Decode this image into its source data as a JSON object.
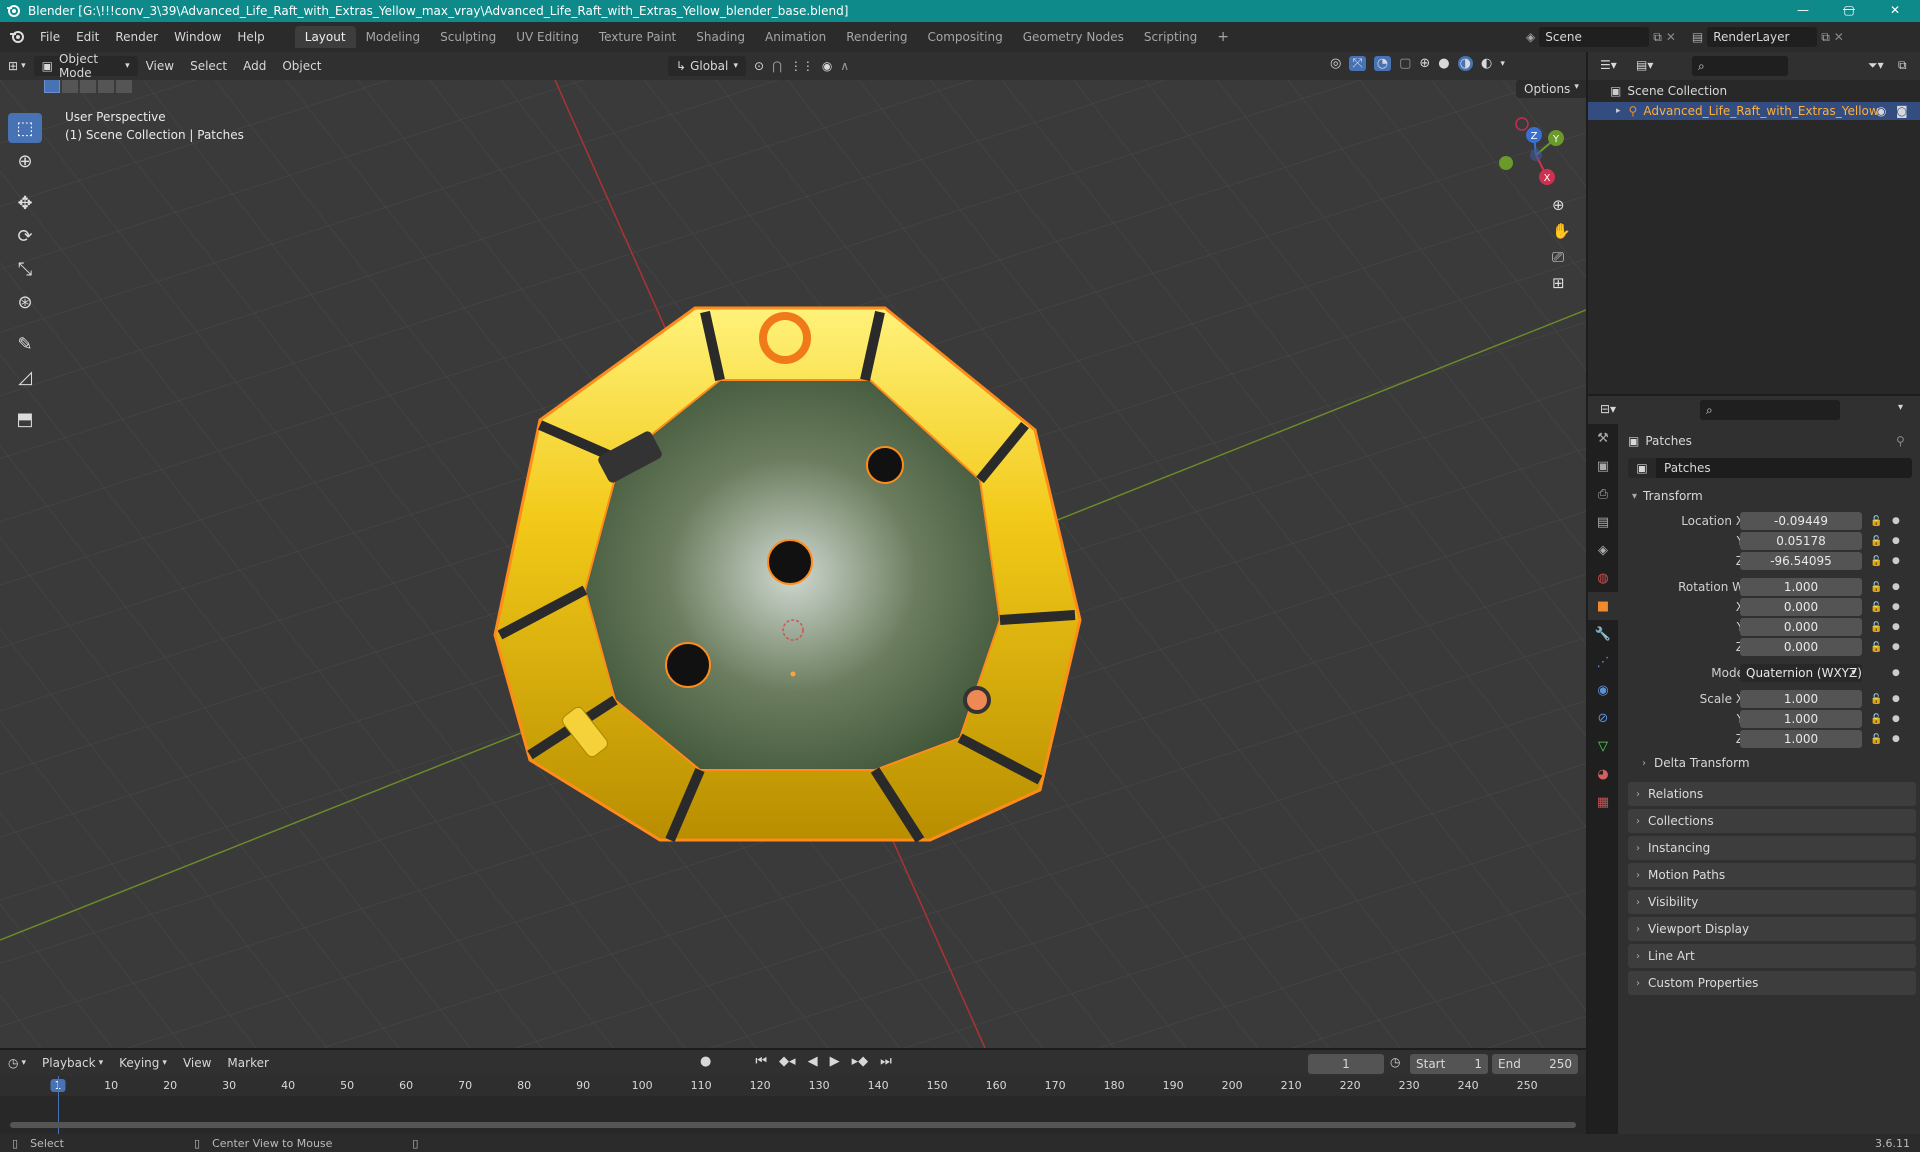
{
  "window": {
    "title": "Blender [G:\\!!!conv_3\\39\\Advanced_Life_Raft_with_Extras_Yellow_max_vray\\Advanced_Life_Raft_with_Extras_Yellow_blender_base.blend]",
    "minimize": "—",
    "maximize": "▢",
    "close": "✕"
  },
  "menu": [
    "File",
    "Edit",
    "Render",
    "Window",
    "Help"
  ],
  "workspaces": [
    "Layout",
    "Modeling",
    "Sculpting",
    "UV Editing",
    "Texture Paint",
    "Shading",
    "Animation",
    "Rendering",
    "Compositing",
    "Geometry Nodes",
    "Scripting"
  ],
  "add_workspace": "+",
  "scene": {
    "name": "Scene",
    "render_layer": "RenderLayer"
  },
  "viewport_header": {
    "mode": "Object Mode",
    "menus": [
      "View",
      "Select",
      "Add",
      "Object"
    ],
    "orientation": "Global",
    "options": "Options"
  },
  "viewport": {
    "perspective": "User Perspective",
    "collection_info": "(1) Scene Collection | Patches",
    "gizmo": {
      "x": "X",
      "y": "Y",
      "z": "Z"
    }
  },
  "outliner": {
    "root": "Scene Collection",
    "item": "Advanced_Life_Raft_with_Extras_Yellow"
  },
  "properties": {
    "object_name": "Patches",
    "datablock": "Patches",
    "transform_title": "Transform",
    "location": {
      "label_x": "Location X",
      "x": "-0.09449",
      "label_y": "Y",
      "y": "0.05178",
      "label_z": "Z",
      "z": "-96.54095"
    },
    "rotation": {
      "label_w": "Rotation W",
      "w": "1.000",
      "label_x": "X",
      "x": "0.000",
      "label_y": "Y",
      "y": "0.000",
      "label_z": "Z",
      "z": "0.000"
    },
    "mode_label": "Mode",
    "mode": "Quaternion (WXYZ)",
    "scale": {
      "label_x": "Scale X",
      "x": "1.000",
      "label_y": "Y",
      "y": "1.000",
      "label_z": "Z",
      "z": "1.000"
    },
    "delta_transform": "Delta Transform",
    "panels": [
      "Relations",
      "Collections",
      "Instancing",
      "Motion Paths",
      "Visibility",
      "Viewport Display",
      "Line Art",
      "Custom Properties"
    ]
  },
  "timeline": {
    "menus": [
      "Playback",
      "Keying",
      "View",
      "Marker"
    ],
    "current_frame": "1",
    "start_label": "Start",
    "start": "1",
    "end_label": "End",
    "end": "250",
    "ticks": [
      "1",
      "10",
      "20",
      "30",
      "40",
      "50",
      "60",
      "70",
      "80",
      "90",
      "100",
      "110",
      "120",
      "130",
      "140",
      "150",
      "160",
      "170",
      "180",
      "190",
      "200",
      "210",
      "220",
      "230",
      "240",
      "250"
    ]
  },
  "statusbar": {
    "select": "Select",
    "center": "Center View to Mouse",
    "version": "3.6.11"
  },
  "colors": {
    "accent": "#4772b3",
    "selection_orange": "#ff8c1a",
    "titlebar": "#0e8a8a",
    "raft_yellow": "#f2c918"
  }
}
